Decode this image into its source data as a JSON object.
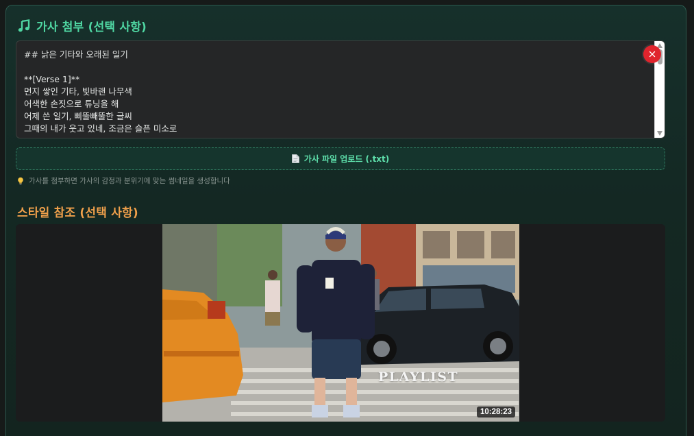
{
  "lyrics_section": {
    "icon": "music-note-icon",
    "title": "가사 첨부 (선택 사항)",
    "text": "## 낡은 기타와 오래된 일기\n\n**[Verse 1]**\n먼지 쌓인 기타, 빛바랜 나무색\n어색한 손짓으로 튜닝을 해\n어제 쓴 일기, 삐뚤빼뚤한 글씨\n그때의 내가 웃고 있네, 조금은 슬픈 미소로",
    "clear_icon": "close-icon",
    "upload_icon": "document-icon",
    "upload_label": "가사 파일 업로드 (.txt)",
    "hint_icon": "lightbulb-icon",
    "hint": "가사를 첨부하면 가사의 감정과 분위기에 맞는 썸네일을 생성합니다"
  },
  "style_section": {
    "title": "스타일 참조 (선택 사항)",
    "thumbnail": {
      "overlay_text": "PLAYLIST",
      "duration": "10:28:23"
    }
  },
  "colors": {
    "accent_green": "#4fd6a2",
    "accent_orange": "#f0a04b",
    "danger_red": "#e0242d"
  }
}
